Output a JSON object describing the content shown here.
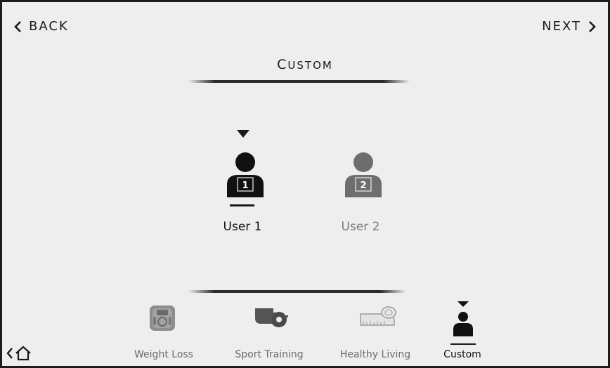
{
  "header": {
    "back_label": "BACK",
    "next_label": "NEXT",
    "title_first": "C",
    "title_rest": "USTOM"
  },
  "users": [
    {
      "label": "User 1",
      "number": "1",
      "selected": true
    },
    {
      "label": "User 2",
      "number": "2",
      "selected": false
    }
  ],
  "tabs": [
    {
      "label": "Weight Loss",
      "icon": "scale-icon"
    },
    {
      "label": "Sport Training",
      "icon": "whistle-icon"
    },
    {
      "label": "Healthy Living",
      "icon": "tape-measure-icon"
    },
    {
      "label": "Custom",
      "icon": "user-icon",
      "selected": true
    }
  ],
  "colors": {
    "background": "#eeeeee",
    "frame": "#1c1c1c",
    "selected_text": "#111111",
    "inactive_text": "#7a7a7a",
    "inactive_avatar": "#6e6e6e"
  }
}
